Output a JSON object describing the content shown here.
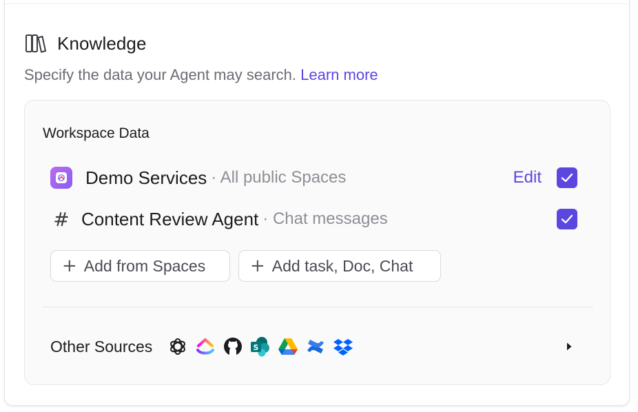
{
  "knowledge": {
    "title": "Knowledge",
    "description": "Specify the data your Agent may search.",
    "learn_more": "Learn more",
    "icon": "books-icon"
  },
  "workspace": {
    "title": "Workspace Data",
    "items": [
      {
        "name": "Demo Services",
        "meta": "· All public Spaces",
        "icon": "workspace-app-icon",
        "edit": "Edit",
        "checked": true
      },
      {
        "name": "Content Review Agent",
        "meta": "· Chat messages",
        "icon": "hash-icon",
        "checked": true
      }
    ],
    "add_spaces": "Add from Spaces",
    "add_task": "Add task, Doc, Chat"
  },
  "other_sources": {
    "label": "Other Sources",
    "icons": [
      "openai-icon",
      "clickup-icon",
      "github-icon",
      "sharepoint-icon",
      "google-drive-icon",
      "confluence-icon",
      "dropbox-icon"
    ]
  },
  "colors": {
    "accent": "#5b47e0",
    "muted": "#8e8e96",
    "panel_bg": "#fafafa"
  }
}
